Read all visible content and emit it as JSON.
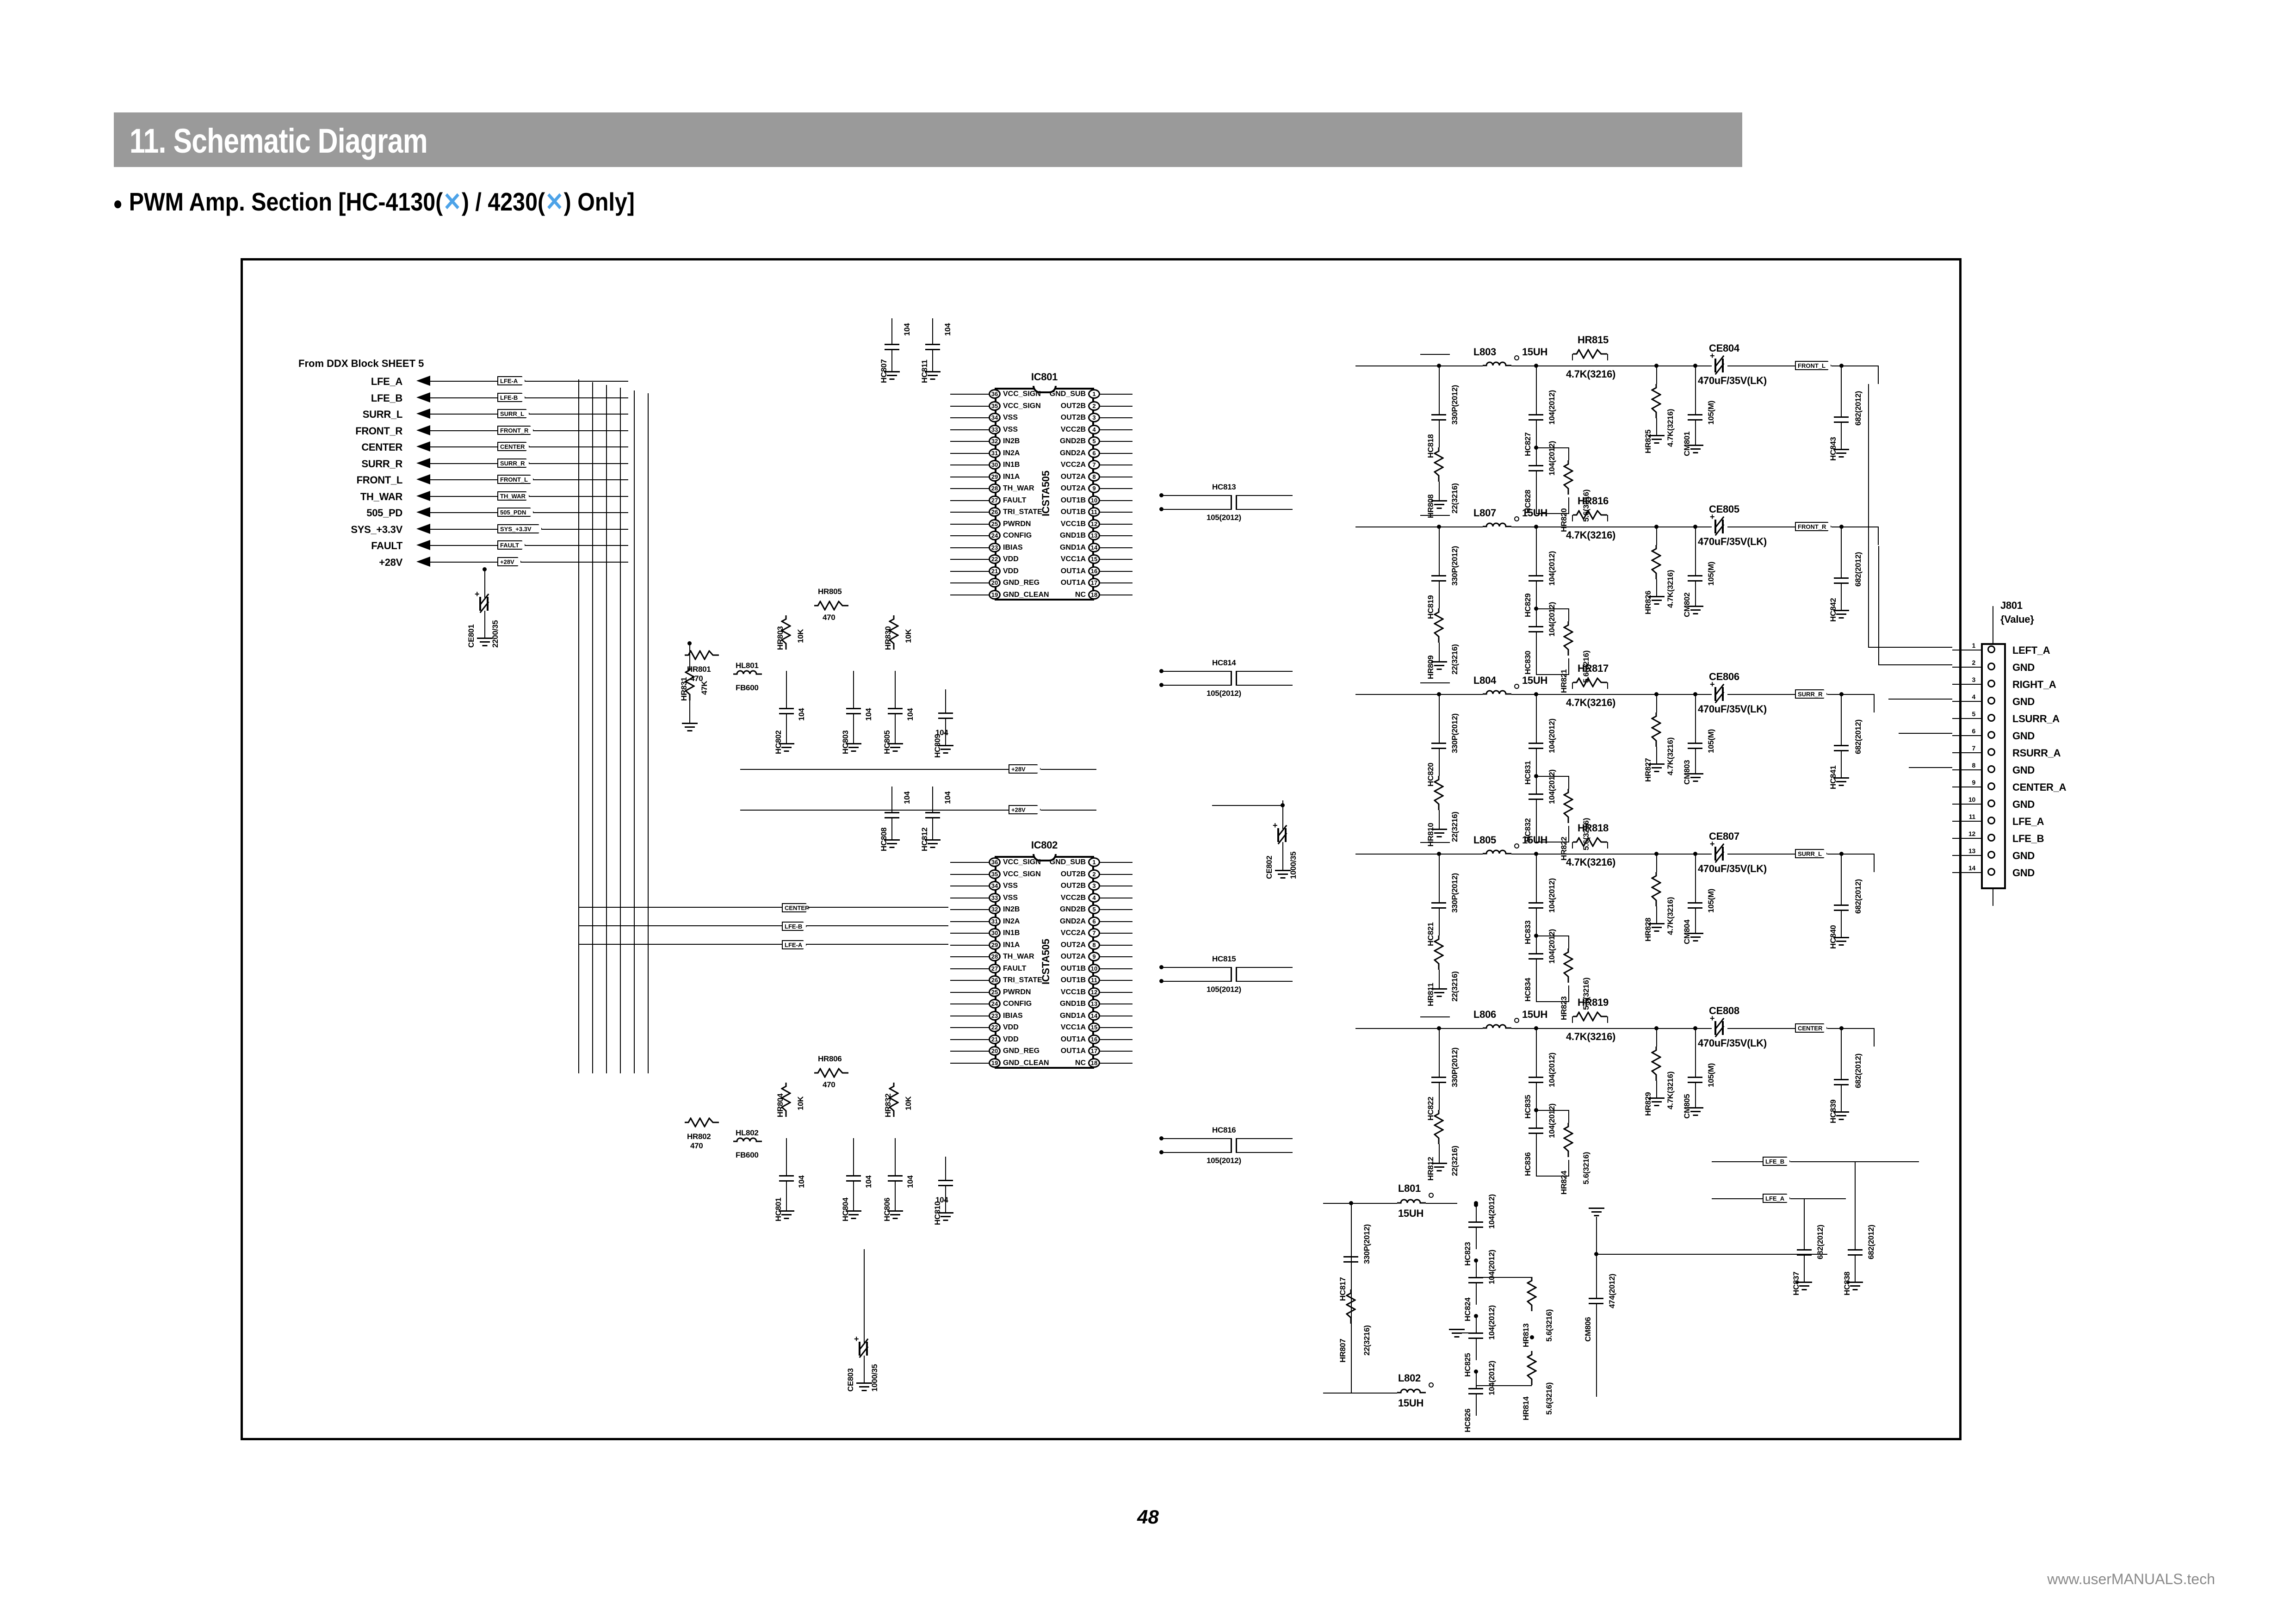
{
  "header": {
    "section_title": "11. Schematic Diagram",
    "subtitle_pre": "PWM Amp. Section [HC-4130(",
    "subtitle_mid": ") / 4230(",
    "subtitle_post": ") Only]",
    "xmark": "✕",
    "bullet": "●"
  },
  "page_number": "48",
  "watermark": "www.userMANUALS.tech",
  "source_note": "From DDX Block  SHEET 5",
  "input_signals": [
    {
      "label": "LFE_A",
      "tag": "LFE-A"
    },
    {
      "label": "LFE_B",
      "tag": "LFE-B"
    },
    {
      "label": "SURR_L",
      "tag": "SURR_L"
    },
    {
      "label": "FRONT_R",
      "tag": "FRONT_R"
    },
    {
      "label": "CENTER",
      "tag": "CENTER"
    },
    {
      "label": "SURR_R",
      "tag": "SURR_R"
    },
    {
      "label": "FRONT_L",
      "tag": "FRONT_L"
    },
    {
      "label": "TH_WAR",
      "tag": "TH_WAR"
    },
    {
      "label": "505_PD",
      "tag": "505_PDN"
    },
    {
      "label": "SYS_+3.3V",
      "tag": "SYS_+3.3V"
    },
    {
      "label": "FAULT",
      "tag": "FAULT"
    },
    {
      "label": "+28V",
      "tag": "+28V"
    }
  ],
  "ics": [
    {
      "ref": "IC801",
      "part": "ICSTA505",
      "left_pins": [
        {
          "n": "36",
          "name": "VCC_SIGN"
        },
        {
          "n": "35",
          "name": "VCC_SIGN"
        },
        {
          "n": "34",
          "name": "VSS"
        },
        {
          "n": "33",
          "name": "VSS"
        },
        {
          "n": "32",
          "name": "IN2B"
        },
        {
          "n": "31",
          "name": "IN2A"
        },
        {
          "n": "30",
          "name": "IN1B"
        },
        {
          "n": "29",
          "name": "IN1A"
        },
        {
          "n": "28",
          "name": "TH_WAR"
        },
        {
          "n": "27",
          "name": "FAULT"
        },
        {
          "n": "26",
          "name": "TRI_STATE"
        },
        {
          "n": "25",
          "name": "PWRDN"
        },
        {
          "n": "24",
          "name": "CONFIG"
        },
        {
          "n": "23",
          "name": "IBIAS"
        },
        {
          "n": "22",
          "name": "VDD"
        },
        {
          "n": "21",
          "name": "VDD"
        },
        {
          "n": "20",
          "name": "GND_REG"
        },
        {
          "n": "19",
          "name": "GND_CLEAN"
        }
      ],
      "right_pins": [
        {
          "n": "1",
          "name": "GND_SUB"
        },
        {
          "n": "2",
          "name": "OUT2B"
        },
        {
          "n": "3",
          "name": "OUT2B"
        },
        {
          "n": "4",
          "name": "VCC2B"
        },
        {
          "n": "5",
          "name": "GND2B"
        },
        {
          "n": "6",
          "name": "GND2A"
        },
        {
          "n": "7",
          "name": "VCC2A"
        },
        {
          "n": "8",
          "name": "OUT2A"
        },
        {
          "n": "9",
          "name": "OUT2A"
        },
        {
          "n": "10",
          "name": "OUT1B"
        },
        {
          "n": "11",
          "name": "OUT1B"
        },
        {
          "n": "12",
          "name": "VCC1B"
        },
        {
          "n": "13",
          "name": "GND1B"
        },
        {
          "n": "14",
          "name": "GND1A"
        },
        {
          "n": "15",
          "name": "VCC1A"
        },
        {
          "n": "16",
          "name": "OUT1A"
        },
        {
          "n": "17",
          "name": "OUT1A"
        },
        {
          "n": "18",
          "name": "NC"
        }
      ]
    },
    {
      "ref": "IC802",
      "part": "ICSTA505",
      "left_pins": [
        {
          "n": "36",
          "name": "VCC_SIGN"
        },
        {
          "n": "35",
          "name": "VCC_SIGN"
        },
        {
          "n": "34",
          "name": "VSS"
        },
        {
          "n": "33",
          "name": "VSS"
        },
        {
          "n": "32",
          "name": "IN2B"
        },
        {
          "n": "31",
          "name": "IN2A"
        },
        {
          "n": "30",
          "name": "IN1B"
        },
        {
          "n": "29",
          "name": "IN1A"
        },
        {
          "n": "28",
          "name": "TH_WAR"
        },
        {
          "n": "27",
          "name": "FAULT"
        },
        {
          "n": "26",
          "name": "TRI_STATE"
        },
        {
          "n": "25",
          "name": "PWRDN"
        },
        {
          "n": "24",
          "name": "CONFIG"
        },
        {
          "n": "23",
          "name": "IBIAS"
        },
        {
          "n": "22",
          "name": "VDD"
        },
        {
          "n": "21",
          "name": "VDD"
        },
        {
          "n": "20",
          "name": "GND_REG"
        },
        {
          "n": "19",
          "name": "GND_CLEAN"
        }
      ],
      "right_pins": [
        {
          "n": "1",
          "name": "GND_SUB"
        },
        {
          "n": "2",
          "name": "OUT2B"
        },
        {
          "n": "3",
          "name": "OUT2B"
        },
        {
          "n": "4",
          "name": "VCC2B"
        },
        {
          "n": "5",
          "name": "GND2B"
        },
        {
          "n": "6",
          "name": "GND2A"
        },
        {
          "n": "7",
          "name": "VCC2A"
        },
        {
          "n": "8",
          "name": "OUT2A"
        },
        {
          "n": "9",
          "name": "OUT2A"
        },
        {
          "n": "10",
          "name": "OUT1B"
        },
        {
          "n": "11",
          "name": "OUT1B"
        },
        {
          "n": "12",
          "name": "VCC1B"
        },
        {
          "n": "13",
          "name": "GND1B"
        },
        {
          "n": "14",
          "name": "GND1A"
        },
        {
          "n": "15",
          "name": "VCC1A"
        },
        {
          "n": "16",
          "name": "OUT1A"
        },
        {
          "n": "17",
          "name": "OUT1A"
        },
        {
          "n": "18",
          "name": "NC"
        }
      ]
    }
  ],
  "connector": {
    "ref": "J801",
    "value": "{Value}",
    "pins": [
      {
        "n": "1",
        "name": "LEFT_A"
      },
      {
        "n": "2",
        "name": "GND"
      },
      {
        "n": "3",
        "name": "RIGHT_A"
      },
      {
        "n": "4",
        "name": "GND"
      },
      {
        "n": "5",
        "name": "LSURR_A"
      },
      {
        "n": "6",
        "name": "GND"
      },
      {
        "n": "7",
        "name": "RSURR_A"
      },
      {
        "n": "8",
        "name": "GND"
      },
      {
        "n": "9",
        "name": "CENTER_A"
      },
      {
        "n": "10",
        "name": "GND"
      },
      {
        "n": "11",
        "name": "LFE_A"
      },
      {
        "n": "12",
        "name": "LFE_B"
      },
      {
        "n": "13",
        "name": "GND"
      },
      {
        "n": "14",
        "name": "GND"
      }
    ]
  },
  "output_stages": [
    {
      "inductor": "L803",
      "ind_val": "15UH",
      "damp_c": "HC818",
      "damp_cv": "330P(2012)",
      "damp_r": "HR808",
      "damp_rv": "22(3216)",
      "fb_r": "HR815",
      "fb_rv": "4.7K(3216)",
      "c1": "HC827",
      "c1v": "104(2012)",
      "c2": "HC828",
      "c2v": "104(2012)",
      "r2": "HR820",
      "r2v": "5.6(3216)",
      "r3": "HR825",
      "r3v": "4.7K(3216)",
      "ecap": "CE804",
      "ecap_v": "470uF/35V(LK)",
      "mlcc": "CM801",
      "mlcc_v": "105(M)",
      "out_tag": "FRONT_L",
      "out_c": "HC843",
      "out_cv": "682(2012)"
    },
    {
      "inductor": "L807",
      "ind_val": "15UH",
      "damp_c": "HC819",
      "damp_cv": "330P(2012)",
      "damp_r": "HR809",
      "damp_rv": "22(3216)",
      "fb_r": "HR816",
      "fb_rv": "4.7K(3216)",
      "c1": "HC829",
      "c1v": "104(2012)",
      "c2": "HC830",
      "c2v": "104(2012)",
      "r2": "HR821",
      "r2v": "5.6(3216)",
      "r3": "HR826",
      "r3v": "4.7K(3216)",
      "ecap": "CE805",
      "ecap_v": "470uF/35V(LK)",
      "mlcc": "CM802",
      "mlcc_v": "105(M)",
      "out_tag": "FRONT_R",
      "out_c": "HC842",
      "out_cv": "682(2012)"
    },
    {
      "inductor": "L804",
      "ind_val": "15UH",
      "damp_c": "HC820",
      "damp_cv": "330P(2012)",
      "damp_r": "HR810",
      "damp_rv": "22(3216)",
      "fb_r": "HR817",
      "fb_rv": "4.7K(3216)",
      "c1": "HC831",
      "c1v": "104(2012)",
      "c2": "HC832",
      "c2v": "104(2012)",
      "r2": "HR822",
      "r2v": "5.6(3216)",
      "r3": "HR827",
      "r3v": "4.7K(3216)",
      "ecap": "CE806",
      "ecap_v": "470uF/35V(LK)",
      "mlcc": "CM803",
      "mlcc_v": "105(M)",
      "out_tag": "SURR_R",
      "out_c": "HC841",
      "out_cv": "682(2012)"
    },
    {
      "inductor": "L805",
      "ind_val": "15UH",
      "damp_c": "HC821",
      "damp_cv": "330P(2012)",
      "damp_r": "HR811",
      "damp_rv": "22(3216)",
      "fb_r": "HR818",
      "fb_rv": "4.7K(3216)",
      "c1": "HC833",
      "c1v": "104(2012)",
      "c2": "HC834",
      "c2v": "104(2012)",
      "r2": "HR823",
      "r2v": "5.6(3216)",
      "r3": "HR828",
      "r3v": "4.7K(3216)",
      "ecap": "CE807",
      "ecap_v": "470uF/35V(LK)",
      "mlcc": "CM804",
      "mlcc_v": "105(M)",
      "out_tag": "SURR_L",
      "out_c": "HC840",
      "out_cv": "682(2012)"
    },
    {
      "inductor": "L806",
      "ind_val": "15UH",
      "damp_c": "HC822",
      "damp_cv": "330P(2012)",
      "damp_r": "HR812",
      "damp_rv": "22(3216)",
      "fb_r": "HR819",
      "fb_rv": "4.7K(3216)",
      "c1": "HC835",
      "c1v": "104(2012)",
      "c2": "HC836",
      "c2v": "104(2012)",
      "r2": "HR824",
      "r2v": "5.6(3216)",
      "r3": "HR829",
      "r3v": "4.7K(3216)",
      "ecap": "CE808",
      "ecap_v": "470uF/35V(LK)",
      "mlcc": "CM805",
      "mlcc_v": "105(M)",
      "out_tag": "CENTER",
      "out_c": "HC839",
      "out_cv": "682(2012)"
    }
  ],
  "lfe_stage": {
    "ind1": "L801",
    "ind1_val": "15UH",
    "ind2": "L802",
    "ind2_val": "15UH",
    "damp_c": "HC817",
    "damp_cv": "330P(2012)",
    "damp_r": "HR807",
    "damp_rv": "22(3216)",
    "c1": "HC823",
    "c1v": "104(2012)",
    "c2": "HC824",
    "c2v": "104(2012)",
    "c3": "HC825",
    "c3v": "104(2012)",
    "c4": "HC826",
    "c4v": "104(2012)",
    "r1": "HR813",
    "r1v": "5.6(3216)",
    "r2": "HR814",
    "r2v": "5.6(3216)",
    "mlcc": "CM806",
    "mlcc_v": "474(2012)",
    "out_tag_a": "LFE_A",
    "out_tag_b": "LFE_B",
    "out_c1": "HC837",
    "out_c1v": "682(2012)",
    "out_c2": "HC838",
    "out_c2v": "682(2012)"
  },
  "bias_ic801": {
    "r_pwrdn": "HR803",
    "r_pwrdn_v": "10K",
    "r_series": "HR805",
    "r_series_v": "470",
    "r_series2": "HR801",
    "r_series2_v": "470",
    "r_bias": "HR830",
    "r_bias_v": "10K",
    "r_ibias": "HR831",
    "r_ibias_v": "47K",
    "ferrite": "HL801",
    "ferrite_v": "FB600",
    "c_vdd": "HC802",
    "c_vdd_v": "104",
    "c_a": "HC803",
    "c_a_v": "104",
    "c_b": "HC805",
    "c_b_v": "104",
    "c_c": "HC809",
    "c_c_v": "104",
    "c_vcc1": "HC807",
    "c_vcc1_v": "104",
    "c_vcc2": "HC811",
    "c_vcc2_v": "104",
    "bulk": "CE801",
    "bulk_v": "2200/35"
  },
  "bias_ic802": {
    "r_pwrdn": "HR804",
    "r_pwrdn_v": "10K",
    "r_series": "HR806",
    "r_series_v": "470",
    "r_series2": "HR802",
    "r_series2_v": "470",
    "r_bias": "HR832",
    "r_bias_v": "10K",
    "ferrite": "HL802",
    "ferrite_v": "FB600",
    "c_vdd": "HC801",
    "c_vdd_v": "104",
    "c_a": "HC804",
    "c_a_v": "104",
    "c_b": "HC806",
    "c_b_v": "104",
    "c_c": "HC810",
    "c_c_v": "104",
    "c_vcc1": "HC808",
    "c_vcc1_v": "104",
    "c_vcc2": "HC812",
    "c_vcc2_v": "104",
    "bulk": "CE803",
    "bulk_v": "1000/35"
  },
  "decoupling_mid": [
    {
      "ref": "HC813",
      "val": "105(2012)"
    },
    {
      "ref": "HC814",
      "val": "105(2012)"
    },
    {
      "ref": "HC815",
      "val": "105(2012)"
    },
    {
      "ref": "HC816",
      "val": "105(2012)"
    }
  ],
  "bulk_mid": {
    "ref": "CE802",
    "val": "1000/35"
  },
  "rail_tag": "+28V"
}
